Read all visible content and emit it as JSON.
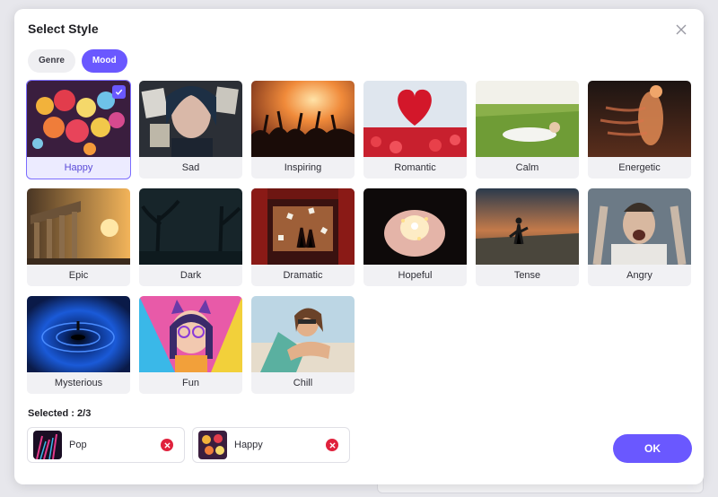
{
  "dialog": {
    "title": "Select Style",
    "close_icon": "close-icon",
    "ok_label": "OK",
    "accent_color": "#6a58ff"
  },
  "tabs": [
    {
      "label": "Genre",
      "active": false
    },
    {
      "label": "Mood",
      "active": true
    }
  ],
  "styles": [
    {
      "label": "Happy",
      "selected": true
    },
    {
      "label": "Sad",
      "selected": false
    },
    {
      "label": "Inspiring",
      "selected": false
    },
    {
      "label": "Romantic",
      "selected": false
    },
    {
      "label": "Calm",
      "selected": false
    },
    {
      "label": "Energetic",
      "selected": false
    },
    {
      "label": "Epic",
      "selected": false
    },
    {
      "label": "Dark",
      "selected": false
    },
    {
      "label": "Dramatic",
      "selected": false
    },
    {
      "label": "Hopeful",
      "selected": false
    },
    {
      "label": "Tense",
      "selected": false
    },
    {
      "label": "Angry",
      "selected": false
    },
    {
      "label": "Mysterious",
      "selected": false
    },
    {
      "label": "Fun",
      "selected": false
    },
    {
      "label": "Chill",
      "selected": false
    }
  ],
  "selection": {
    "label": "Selected : 2/3",
    "items": [
      {
        "label": "Pop",
        "remove_icon": "remove-icon"
      },
      {
        "label": "Happy",
        "remove_icon": "remove-icon"
      }
    ]
  }
}
